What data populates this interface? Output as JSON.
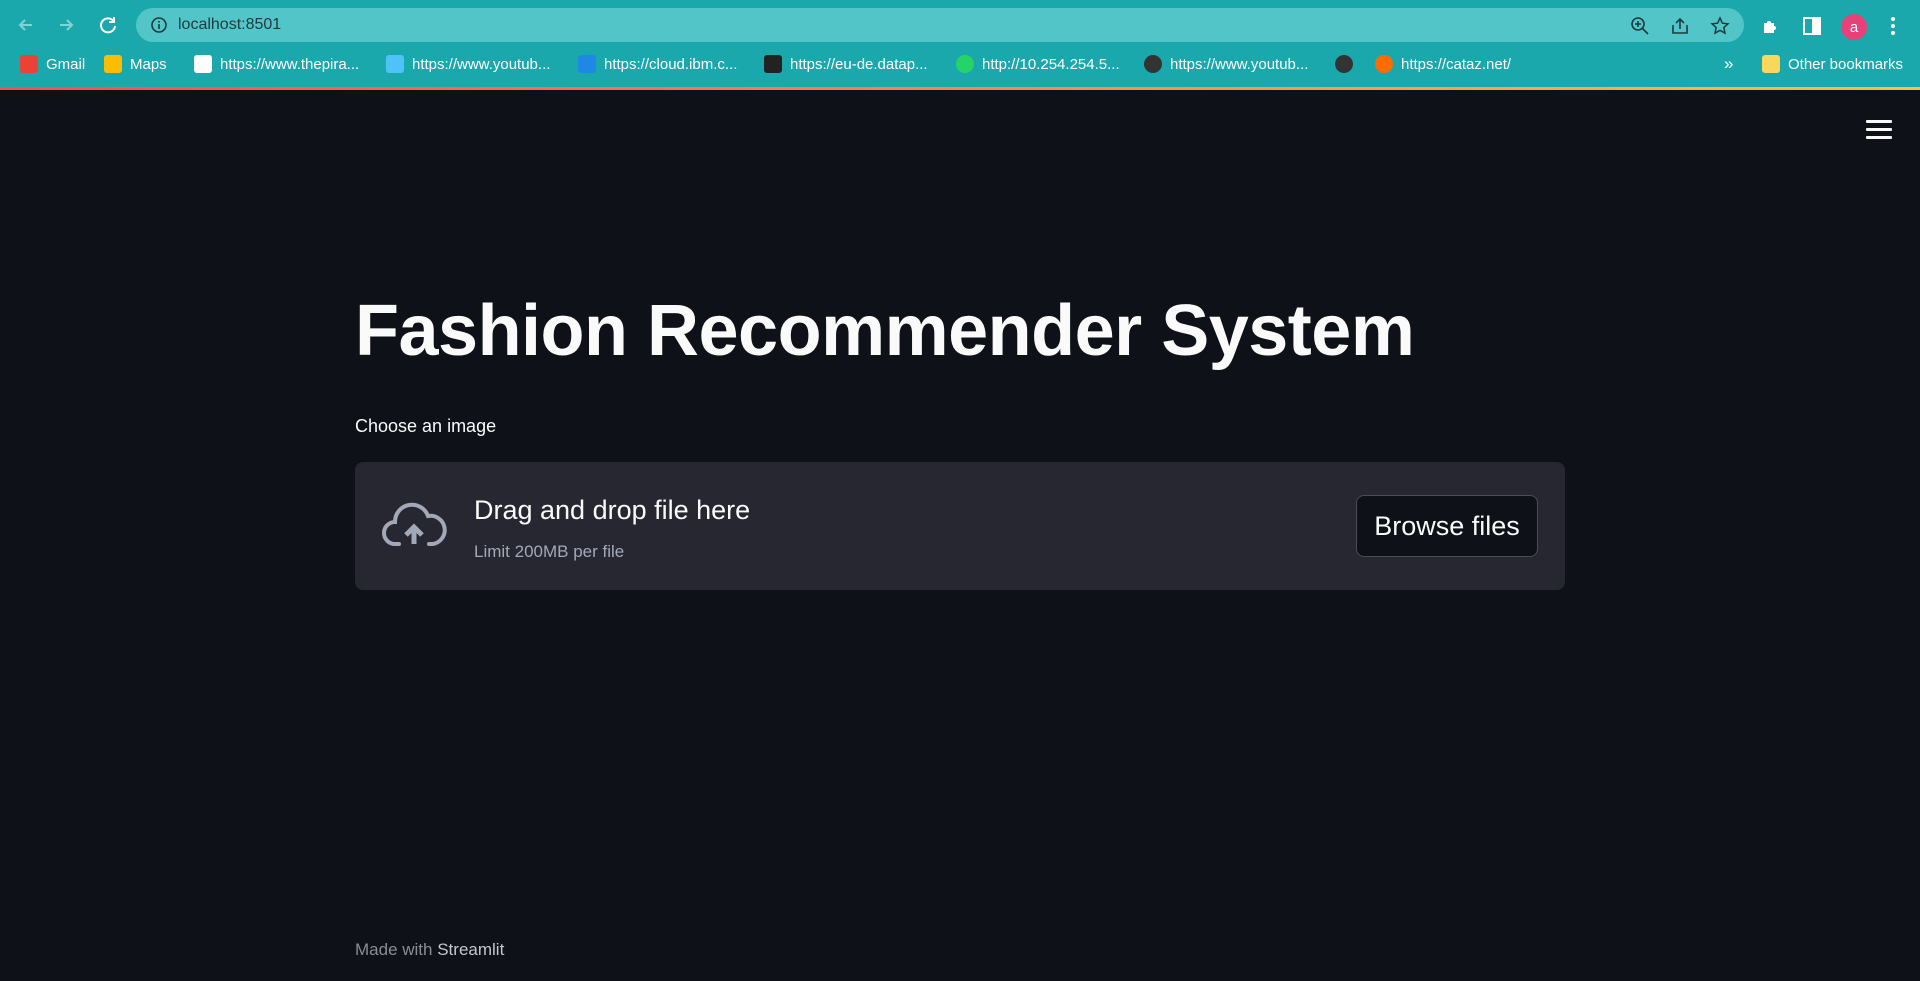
{
  "browser": {
    "url": "localhost:8501",
    "avatar_letter": "a",
    "bookmarks": [
      {
        "label": "Gmail",
        "color": "#ea4335"
      },
      {
        "label": "Maps",
        "color": "#fbbc04"
      },
      {
        "label": "https://www.thepira...",
        "color": "#ffffff"
      },
      {
        "label": "https://www.youtub...",
        "color": "#4fc3f7"
      },
      {
        "label": "https://cloud.ibm.c...",
        "color": "#1e88e5"
      },
      {
        "label": "https://eu-de.datap...",
        "color": "#222222"
      },
      {
        "label": "http://10.254.254.5...",
        "color": "#25d366"
      },
      {
        "label": "https://www.youtub...",
        "color": "#333333"
      },
      {
        "label": "",
        "color": "#333333"
      },
      {
        "label": "https://cataz.net/",
        "color": "#ff6d00"
      }
    ],
    "more_label": "»",
    "other_bookmarks": "Other bookmarks"
  },
  "app": {
    "title": "Fashion Recommender System",
    "uploader_label": "Choose an image",
    "dropzone_text": "Drag and drop file here",
    "dropzone_limit": "Limit 200MB per file",
    "browse_button": "Browse files",
    "footer_prefix": "Made with",
    "footer_brand": "Streamlit"
  },
  "colors": {
    "chrome": "#1ba8ad",
    "background": "#0e1117",
    "dropzone": "#262730",
    "accent": "#ff4b4b"
  }
}
